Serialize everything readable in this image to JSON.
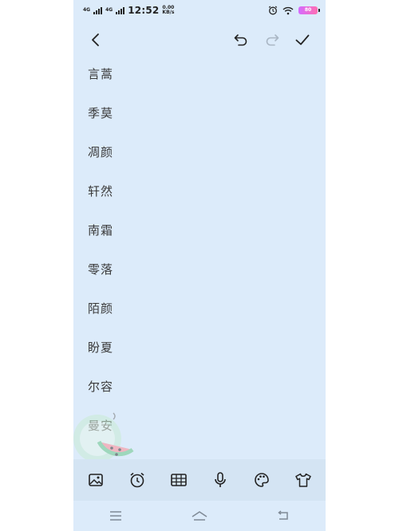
{
  "status_bar": {
    "network_1": "4G",
    "network_2": "4G",
    "time": "12:52",
    "speed_value": "0.00",
    "speed_unit": "KB/s",
    "battery": "80"
  },
  "toolbar": {
    "back_icon": "chevron-left-icon",
    "undo_icon": "undo-icon",
    "redo_icon": "redo-icon",
    "confirm_icon": "check-icon"
  },
  "names": [
    "言蒿",
    "季莫",
    "凋颜",
    "轩然",
    "南霜",
    "零落",
    "陌颜",
    "盼夏",
    "尔容",
    "曼安"
  ],
  "tools": [
    "image-icon",
    "alarm-icon",
    "table-icon",
    "microphone-icon",
    "palette-icon",
    "shirt-icon"
  ],
  "nav": [
    "menu-icon",
    "home-icon",
    "back-icon"
  ],
  "colors": {
    "background": "#dcebfa",
    "tool_row": "#d4e4f3",
    "text": "#3a3a3a"
  }
}
